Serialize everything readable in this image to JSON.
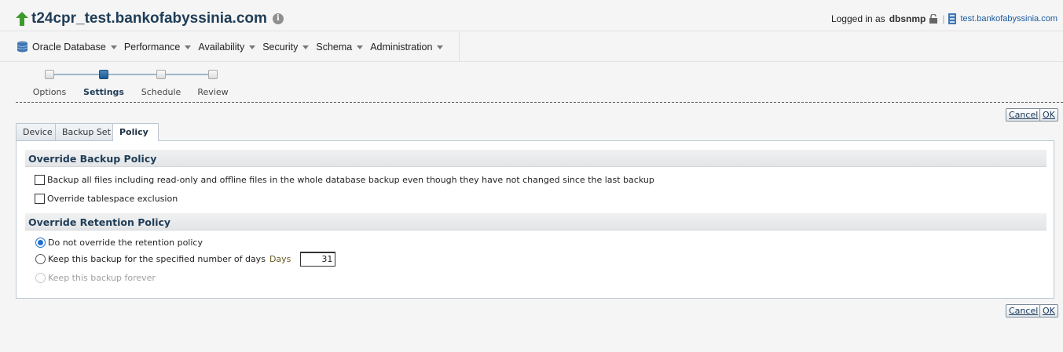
{
  "header": {
    "title": "t24cpr_test.bankofabyssinia.com",
    "logged_in_label": "Logged in as",
    "username": "dbsnmp",
    "separator": "|",
    "host": "test.bankofabyssinia.com",
    "info_glyph": "i"
  },
  "menu": {
    "items": [
      {
        "label": "Oracle Database",
        "icon": "database-icon"
      },
      {
        "label": "Performance"
      },
      {
        "label": "Availability"
      },
      {
        "label": "Security"
      },
      {
        "label": "Schema"
      },
      {
        "label": "Administration"
      }
    ]
  },
  "train": {
    "steps": [
      {
        "label": "Options",
        "current": false
      },
      {
        "label": "Settings",
        "current": true
      },
      {
        "label": "Schedule",
        "current": false
      },
      {
        "label": "Review",
        "current": false
      }
    ]
  },
  "buttons": {
    "cancel": "Cancel",
    "ok": "OK"
  },
  "tabs": [
    {
      "label": "Device",
      "active": false
    },
    {
      "label": "Backup Set",
      "active": false
    },
    {
      "label": "Policy",
      "active": true
    }
  ],
  "override_backup": {
    "heading": "Override Backup Policy",
    "backup_all_label": "Backup all files including read-only and offline files in the whole database backup even though they have not changed since the last backup",
    "backup_all_checked": false,
    "tablespace_label": "Override tablespace exclusion",
    "tablespace_checked": false
  },
  "retention": {
    "heading": "Override Retention Policy",
    "no_override_label": "Do not override the retention policy",
    "keep_days_label": "Keep this backup for the specified number of days",
    "days_label": "Days",
    "days_value": "31",
    "keep_forever_label": "Keep this backup forever",
    "selected": "no_override"
  },
  "colors": {
    "title": "#1f3d57",
    "link": "#1b5a9e",
    "radio_selected": "#1f6fcf",
    "train_current": "#1d5a92"
  }
}
